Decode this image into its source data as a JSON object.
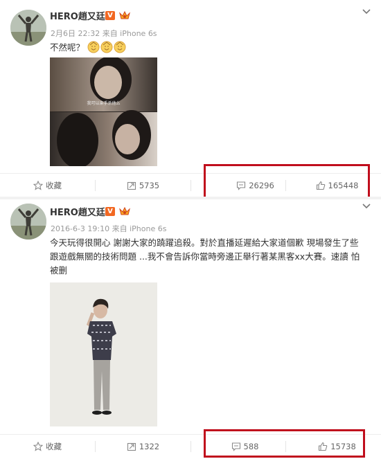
{
  "posts": [
    {
      "author": "HERO趙又廷",
      "verified_badge": "V",
      "timestamp": "2月6日 22:32 来自 iPhone 6s",
      "text": "不然呢？",
      "emoji_icons": [
        "bless-face-icon",
        "bless-face-icon",
        "bless-face-icon"
      ],
      "image_subtitle": "我可以亲手杀他么",
      "actions": {
        "collect": "收藏",
        "repost": "5735",
        "comment": "26296",
        "like": "165448"
      }
    },
    {
      "author": "HERO趙又廷",
      "verified_badge": "V",
      "timestamp": "2016-6-3 19:10 来自 iPhone 6s",
      "text_lines": [
        "今天玩得很開心 謝謝大家的蹺躍追殺。對於直播延遲給大家道個歉 現場發生了些",
        "跟遊戲無關的技術問題 ...我不會告訴你當時旁邊正舉行著某黑客xx大賽。速讀 怕",
        "被删"
      ],
      "actions": {
        "collect": "收藏",
        "repost": "1322",
        "comment": "588",
        "like": "15738"
      }
    }
  ],
  "colors": {
    "highlight_box": "#c00d1c",
    "vip_badge": "#f26822",
    "text": "#333333",
    "meta": "#999999"
  }
}
